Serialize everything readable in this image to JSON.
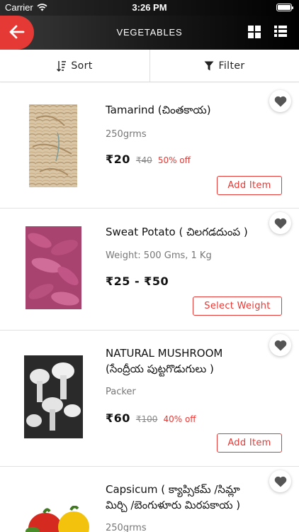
{
  "status_bar": {
    "carrier": "Carrier",
    "time": "3:26 PM"
  },
  "header": {
    "title": "VEGETABLES",
    "icons": [
      "back-arrow-icon",
      "grid-view-icon",
      "list-view-icon"
    ],
    "accent_color": "#e53935"
  },
  "toolbar": {
    "sort_label": "Sort",
    "filter_label": "Filter"
  },
  "products": [
    {
      "name": "Tamarind (చింతకాయ)",
      "quantity": "250grms",
      "price": "₹20",
      "old_price": "₹40",
      "discount": "50% off",
      "action": "Add Item"
    },
    {
      "name": "Sweat Potato ( చిలగడదుంప )",
      "quantity": "Weight: 500 Gms, 1 Kg",
      "price": "₹25 - ₹50",
      "action": "Select Weight"
    },
    {
      "name_line1": "NATURAL MUSHROOM",
      "name_line2": "(సేంద్రీయ పుట్టగొడుగులు )",
      "quantity": "Packer",
      "price": "₹60",
      "old_price": "₹100",
      "discount": "40% off",
      "action": "Add Item"
    },
    {
      "name_line1": "Capsicum ( క్యాప్సికమ్ /సిమ్లా",
      "name_line2": "మిర్చి /బెంగుళూరు మిరపకాయ )",
      "quantity": "250grms"
    }
  ]
}
